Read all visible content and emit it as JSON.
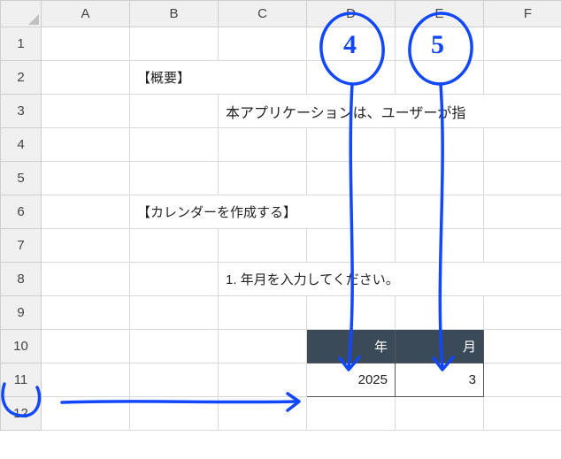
{
  "columns": [
    "A",
    "B",
    "C",
    "D",
    "E",
    "F"
  ],
  "rows": [
    "1",
    "2",
    "3",
    "4",
    "5",
    "6",
    "7",
    "8",
    "9",
    "10",
    "11",
    "12"
  ],
  "cells": {
    "B2": "【概要】",
    "C3": "本アプリケーションは、ユーザーが指",
    "B6": "【カレンダーを作成する】",
    "C8": "1. 年月を入力してください。",
    "D10": "年",
    "E10": "月",
    "D11": "2025",
    "E11": "3"
  },
  "annotations": {
    "circle_d": "4",
    "circle_e": "5"
  }
}
